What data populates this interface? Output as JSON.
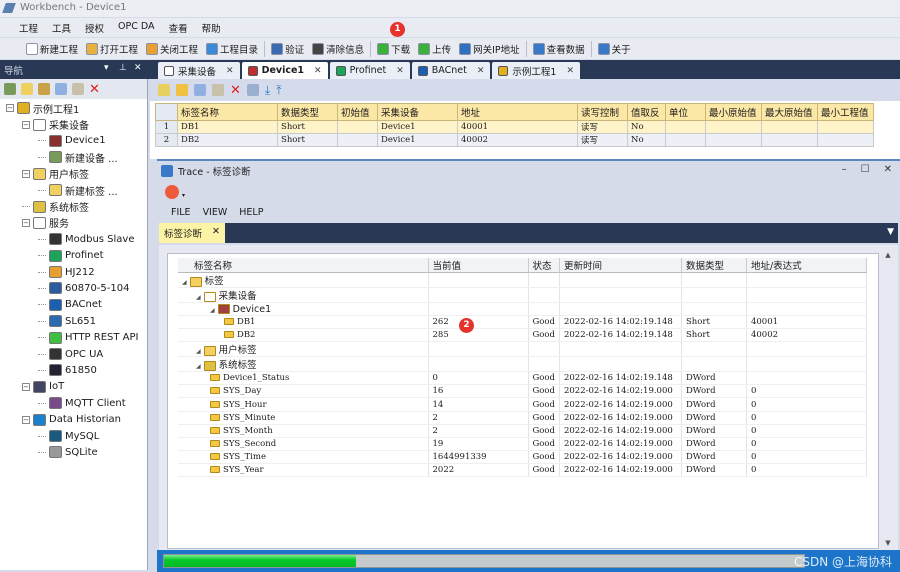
{
  "window": {
    "title": "Workbench - Device1"
  },
  "menu": [
    "工程",
    "工具",
    "授权",
    "OPC DA",
    "查看",
    "帮助"
  ],
  "toolbar": [
    {
      "label": "新建工程",
      "icon": "new-file-icon"
    },
    {
      "label": "打开工程",
      "icon": "open-folder-icon"
    },
    {
      "label": "关闭工程",
      "icon": "close-folder-icon"
    },
    {
      "label": "工程目录",
      "icon": "directory-icon"
    },
    {
      "label": "验证",
      "icon": "check-icon"
    },
    {
      "label": "清除信息",
      "icon": "clear-icon"
    },
    {
      "label": "下载",
      "icon": "download-arrow-icon"
    },
    {
      "label": "上传",
      "icon": "upload-arrow-icon"
    },
    {
      "label": "网关IP地址",
      "icon": "network-icon"
    },
    {
      "label": "查看数据",
      "icon": "monitor-icon"
    },
    {
      "label": "关于",
      "icon": "help-icon"
    }
  ],
  "annotations": [
    "1",
    "2"
  ],
  "nav": {
    "title": "导航",
    "tree": [
      {
        "label": "示例工程1",
        "level": 0,
        "icon": "project-icon"
      },
      {
        "label": "采集设备",
        "level": 1,
        "icon": "device-group-icon"
      },
      {
        "label": "Device1",
        "level": 2,
        "icon": "device-icon"
      },
      {
        "label": "新建设备 ...",
        "level": 2,
        "icon": "new-device-icon"
      },
      {
        "label": "用户标签",
        "level": 1,
        "icon": "user-tags-icon"
      },
      {
        "label": "新建标签 ...",
        "level": 2,
        "icon": "new-tag-icon"
      },
      {
        "label": "系统标签",
        "level": 1,
        "icon": "system-tags-icon"
      },
      {
        "label": "服务",
        "level": 1,
        "icon": "services-icon"
      },
      {
        "label": "Modbus Slave",
        "level": 2,
        "icon": "modbus-icon"
      },
      {
        "label": "Profinet",
        "level": 2,
        "icon": "profinet-icon"
      },
      {
        "label": "HJ212",
        "level": 2,
        "icon": "hj212-icon"
      },
      {
        "label": "60870-5-104",
        "level": 2,
        "icon": "iec-icon"
      },
      {
        "label": "BACnet",
        "level": 2,
        "icon": "bacnet-icon"
      },
      {
        "label": "SL651",
        "level": 2,
        "icon": "sl651-icon"
      },
      {
        "label": "HTTP REST API",
        "level": 2,
        "icon": "http-icon"
      },
      {
        "label": "OPC UA",
        "level": 2,
        "icon": "opcua-icon"
      },
      {
        "label": "61850",
        "level": 2,
        "icon": "iec61850-icon"
      },
      {
        "label": "IoT",
        "level": 1,
        "icon": "iot-icon"
      },
      {
        "label": "MQTT Client",
        "level": 2,
        "icon": "mqtt-icon"
      },
      {
        "label": "Data Historian",
        "level": 1,
        "icon": "database-icon"
      },
      {
        "label": "MySQL",
        "level": 2,
        "icon": "mysql-icon"
      },
      {
        "label": "SQLite",
        "level": 2,
        "icon": "sqlite-icon"
      }
    ]
  },
  "tabs": [
    {
      "label": "采集设备",
      "active": false
    },
    {
      "label": "Device1",
      "active": true
    },
    {
      "label": "Profinet",
      "active": false
    },
    {
      "label": "BACnet",
      "active": false
    },
    {
      "label": "示例工程1",
      "active": false
    }
  ],
  "tag_table": {
    "columns": [
      "标签名称",
      "数据类型",
      "初始值",
      "采集设备",
      "地址",
      "读写控制",
      "值取反",
      "单位",
      "最小原始值",
      "最大原始值",
      "最小工程值"
    ],
    "rows": [
      [
        "1",
        "DB1",
        "Short",
        "",
        "Device1",
        "40001",
        "读写",
        "No",
        "",
        "",
        "",
        ""
      ],
      [
        "2",
        "DB2",
        "Short",
        "",
        "Device1",
        "40002",
        "读写",
        "No",
        "",
        "",
        "",
        ""
      ]
    ]
  },
  "trace": {
    "title": "Trace - 标签诊断",
    "menu": [
      "FILE",
      "VIEW",
      "HELP"
    ],
    "tab": "标签诊断",
    "columns": [
      "标签名称",
      "当前值",
      "状态",
      "更新时间",
      "数据类型",
      "地址/表达式"
    ],
    "rows": [
      {
        "name": "标签",
        "level": 0,
        "group": true
      },
      {
        "name": "采集设备",
        "level": 1,
        "group": true
      },
      {
        "name": "Device1",
        "level": 2,
        "group": true
      },
      {
        "name": "DB1",
        "level": 3,
        "value": "262",
        "status": "Good",
        "time": "2022-02-16 14:02:19.148",
        "type": "Short",
        "addr": "40001"
      },
      {
        "name": "DB2",
        "level": 3,
        "value": "285",
        "status": "Good",
        "time": "2022-02-16 14:02:19.148",
        "type": "Short",
        "addr": "40002"
      },
      {
        "name": "用户标签",
        "level": 1,
        "group": true
      },
      {
        "name": "系统标签",
        "level": 1,
        "group": true
      },
      {
        "name": "Device1_Status",
        "level": 2,
        "value": "0",
        "status": "Good",
        "time": "2022-02-16 14:02:19.148",
        "type": "DWord",
        "addr": ""
      },
      {
        "name": "SYS_Day",
        "level": 2,
        "value": "16",
        "status": "Good",
        "time": "2022-02-16 14:02:19.000",
        "type": "DWord",
        "addr": "0"
      },
      {
        "name": "SYS_Hour",
        "level": 2,
        "value": "14",
        "status": "Good",
        "time": "2022-02-16 14:02:19.000",
        "type": "DWord",
        "addr": "0"
      },
      {
        "name": "SYS_Minute",
        "level": 2,
        "value": "2",
        "status": "Good",
        "time": "2022-02-16 14:02:19.000",
        "type": "DWord",
        "addr": "0"
      },
      {
        "name": "SYS_Month",
        "level": 2,
        "value": "2",
        "status": "Good",
        "time": "2022-02-16 14:02:19.000",
        "type": "DWord",
        "addr": "0"
      },
      {
        "name": "SYS_Second",
        "level": 2,
        "value": "19",
        "status": "Good",
        "time": "2022-02-16 14:02:19.000",
        "type": "DWord",
        "addr": "0"
      },
      {
        "name": "SYS_Time",
        "level": 2,
        "value": "1644991339",
        "status": "Good",
        "time": "2022-02-16 14:02:19.000",
        "type": "DWord",
        "addr": "0"
      },
      {
        "name": "SYS_Year",
        "level": 2,
        "value": "2022",
        "status": "Good",
        "time": "2022-02-16 14:02:19.000",
        "type": "DWord",
        "addr": "0"
      }
    ],
    "progress_percent": 30
  },
  "watermark": "CSDN @上海协科",
  "colors": {
    "dark_strip": "#293955",
    "header_yellow": "#fbe7a6",
    "status_blue": "#1c75c8",
    "progress_green": "#07c82d",
    "badge_red": "#e5322d"
  }
}
